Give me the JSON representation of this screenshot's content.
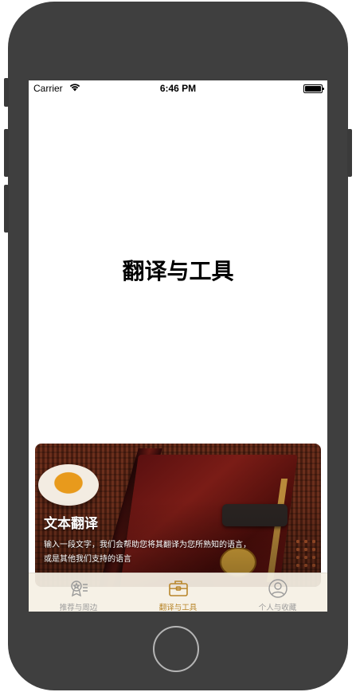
{
  "status_bar": {
    "carrier": "Carrier",
    "time": "6:46 PM"
  },
  "main": {
    "title": "翻译与工具"
  },
  "card": {
    "title": "文本翻译",
    "description_line1": "输入一段文字，我们会帮助您将其翻译为您所熟知的语言，",
    "description_line2": "或是其他我们支持的语言"
  },
  "tab_bar": {
    "tabs": [
      {
        "label": "推荐与周边",
        "icon": "award-list-icon",
        "active": false
      },
      {
        "label": "翻译与工具",
        "icon": "toolbox-icon",
        "active": true
      },
      {
        "label": "个人与收藏",
        "icon": "person-icon",
        "active": false
      }
    ]
  },
  "colors": {
    "tab_active": "#b8862b",
    "tab_inactive": "#9a9a9a",
    "device_frame": "#3f3f3f"
  }
}
